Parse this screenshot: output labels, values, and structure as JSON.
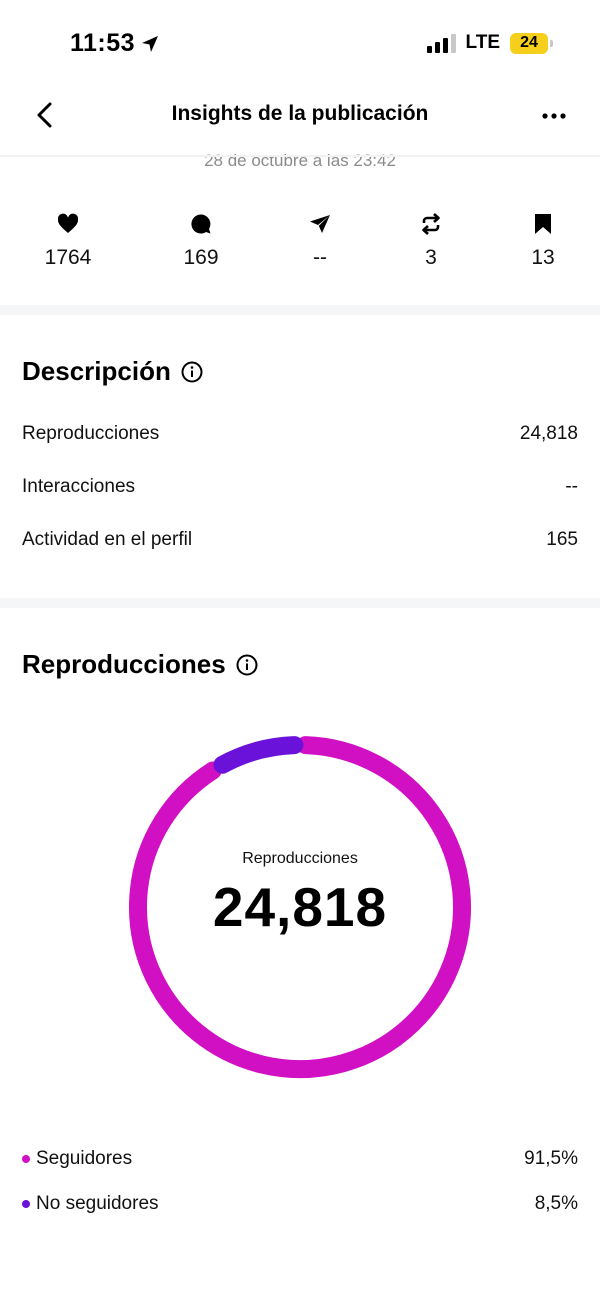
{
  "status_bar": {
    "time": "11:53",
    "network": "LTE",
    "battery": "24"
  },
  "nav": {
    "title": "Insights de la publicación"
  },
  "post_date": "28 de octubre a las 23:42",
  "stats": {
    "likes": "1764",
    "comments": "169",
    "shares": "--",
    "reposts": "3",
    "saves": "13"
  },
  "overview": {
    "title": "Descripción",
    "rows": [
      {
        "label": "Reproducciones",
        "value": "24,818"
      },
      {
        "label": "Interacciones",
        "value": "--"
      },
      {
        "label": "Actividad en el perfil",
        "value": "165"
      }
    ]
  },
  "views": {
    "title": "Reproducciones",
    "center_label": "Reproducciones",
    "center_value": "24,818",
    "legend": [
      {
        "label": "Seguidores",
        "value": "91,5%",
        "color": "#d10fc3"
      },
      {
        "label": "No seguidores",
        "value": "8,5%",
        "color": "#6a12d9"
      }
    ]
  },
  "chart_data": {
    "type": "pie",
    "categories": [
      "Seguidores",
      "No seguidores"
    ],
    "values": [
      91.5,
      8.5
    ],
    "colors": [
      "#d10fc3",
      "#6a12d9"
    ],
    "title": "Reproducciones",
    "total": 24818
  }
}
